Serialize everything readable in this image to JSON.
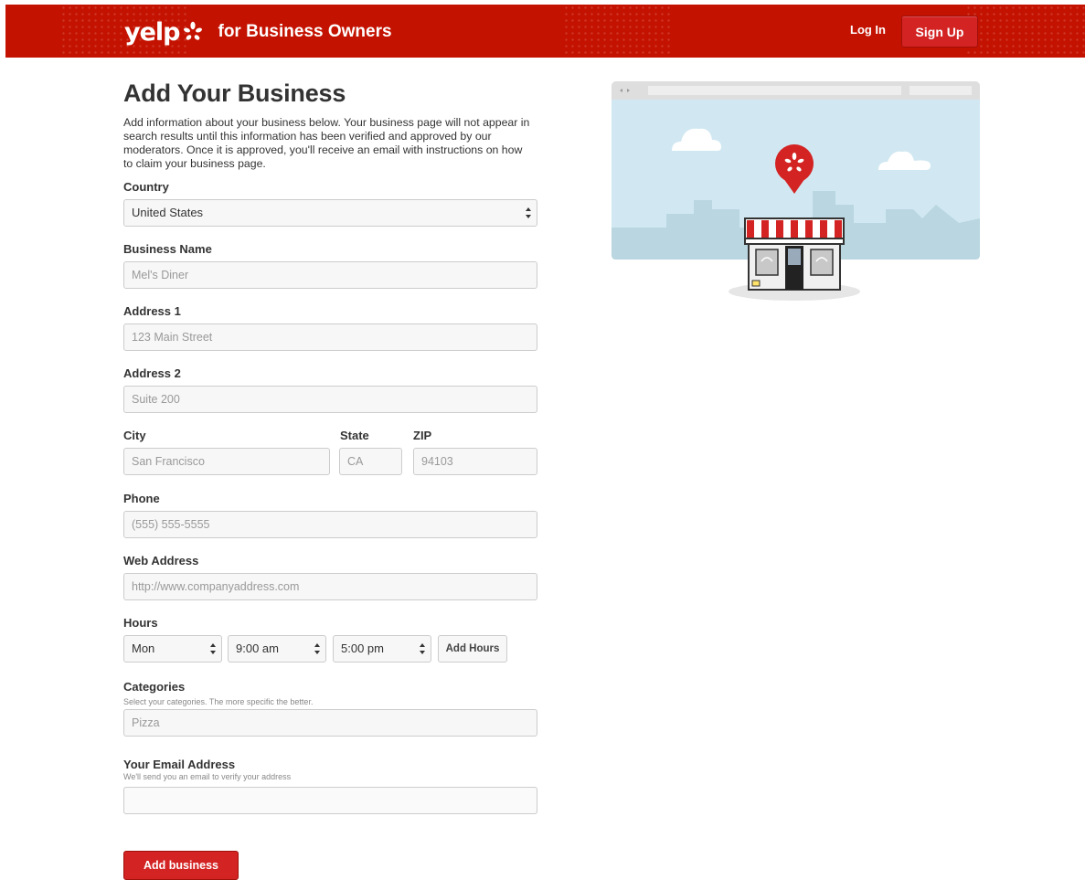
{
  "header": {
    "logo_text": "yelp",
    "tagline": "for Business Owners",
    "login_label": "Log In",
    "signup_label": "Sign Up",
    "brand_color": "#c41200"
  },
  "form": {
    "title": "Add Your Business",
    "intro": "Add information about your business below. Your business page will not appear in search results until this information has been verified and approved by our moderators. Once it is approved, you'll receive an email with instructions on how to claim your business page.",
    "country": {
      "label": "Country",
      "value": "United States"
    },
    "business_name": {
      "label": "Business Name",
      "placeholder": "Mel's Diner"
    },
    "address1": {
      "label": "Address 1",
      "placeholder": "123 Main Street"
    },
    "address2": {
      "label": "Address 2",
      "placeholder": "Suite 200"
    },
    "city": {
      "label": "City",
      "placeholder": "San Francisco"
    },
    "state": {
      "label": "State",
      "placeholder": "CA"
    },
    "zip": {
      "label": "ZIP",
      "placeholder": "94103"
    },
    "phone": {
      "label": "Phone",
      "placeholder": "(555) 555-5555"
    },
    "web": {
      "label": "Web Address",
      "placeholder": "http://www.companyaddress.com"
    },
    "hours": {
      "label": "Hours",
      "day": "Mon",
      "open": "9:00 am",
      "close": "5:00 pm",
      "add_label": "Add Hours"
    },
    "categories": {
      "label": "Categories",
      "hint": "Select your categories. The more specific the better.",
      "placeholder": "Pizza"
    },
    "email": {
      "label": "Your Email Address",
      "hint": "We'll send you an email to verify your address",
      "placeholder": ""
    },
    "submit_label": "Add business"
  },
  "illustration": {
    "icons": [
      "browser-window-icon",
      "cloud-icon",
      "map-pin-icon",
      "storefront-icon"
    ]
  }
}
